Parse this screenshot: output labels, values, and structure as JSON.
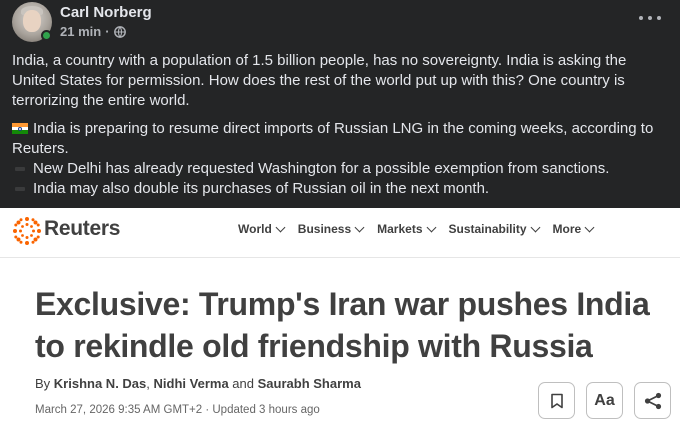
{
  "post": {
    "author": "Carl Norberg",
    "time": "21 min",
    "separator": "·",
    "paragraph1": "India, a country with a population of 1.5 billion people, has no sovereignty. India is asking the United States for permission. How does the rest of the world put up with this? One country is terrorizing the entire world.",
    "paragraph2": "India is preparing to resume direct imports of Russian LNG in the coming weeks, according to Reuters.",
    "bullets": [
      "New Delhi has already requested Washington for a possible exemption from sanctions.",
      "India may also double its purchases of Russian oil in the next month."
    ],
    "icons": {
      "privacy": "globe-icon",
      "menu": "more-options-icon",
      "flag": "india-flag-icon",
      "bullet": "black-bullet-icon"
    },
    "colors": {
      "background": "#242526",
      "text": "#e4e6eb",
      "online": "#31a24c"
    }
  },
  "reuters": {
    "brand": "Reuters",
    "nav": [
      {
        "label": "World"
      },
      {
        "label": "Business"
      },
      {
        "label": "Markets"
      },
      {
        "label": "Sustainability"
      },
      {
        "label": "More"
      }
    ],
    "headline": "Exclusive: Trump's Iran war pushes India to rekindle old friendship with Russia",
    "byline": {
      "prefix": "By",
      "author1": "Krishna N. Das",
      "comma": ",",
      "author2": "Nidhi Verma",
      "and": "and",
      "author3": "Saurabh Sharma"
    },
    "dateline": "March 27, 2026 9:35 AM GMT+2 · Updated 3 hours ago",
    "tools": {
      "text_size_label": "Aa"
    },
    "colors": {
      "logo": "#fa6400",
      "text": "#404040"
    }
  }
}
